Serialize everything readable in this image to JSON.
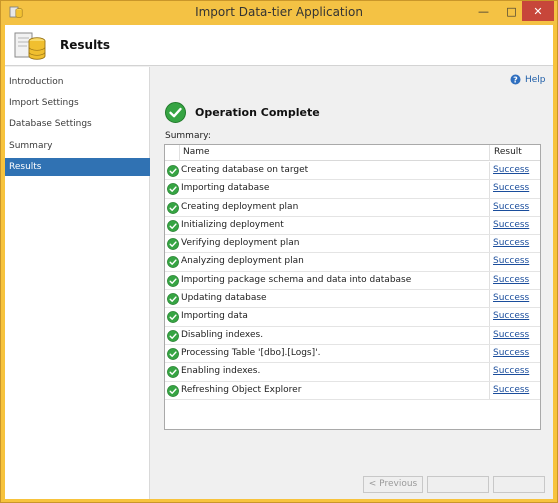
{
  "window": {
    "title": "Import Data-tier Application"
  },
  "titlebar": {
    "minimize": "—",
    "maximize": "□",
    "close": "✕"
  },
  "header": {
    "title": "Results"
  },
  "sidebar": {
    "items": [
      {
        "label": "Introduction",
        "active": false
      },
      {
        "label": "Import Settings",
        "active": false
      },
      {
        "label": "Database Settings",
        "active": false
      },
      {
        "label": "Summary",
        "active": false
      },
      {
        "label": "Results",
        "active": true
      }
    ]
  },
  "main": {
    "help_label": "Help",
    "operation_title": "Operation Complete",
    "summary_label": "Summary:",
    "columns": {
      "name": "Name",
      "result": "Result"
    },
    "rows": [
      {
        "name": "Creating database on target",
        "result": "Success"
      },
      {
        "name": "Importing database",
        "result": "Success"
      },
      {
        "name": "Creating deployment plan",
        "result": "Success"
      },
      {
        "name": "Initializing deployment",
        "result": "Success"
      },
      {
        "name": "Verifying deployment plan",
        "result": "Success"
      },
      {
        "name": "Analyzing deployment plan",
        "result": "Success"
      },
      {
        "name": "Importing package schema and data into database",
        "result": "Success"
      },
      {
        "name": "Updating database",
        "result": "Success"
      },
      {
        "name": "Importing data",
        "result": "Success"
      },
      {
        "name": "Disabling indexes.",
        "result": "Success"
      },
      {
        "name": "Processing Table '[dbo].[Logs]'.",
        "result": "Success"
      },
      {
        "name": "Enabling indexes.",
        "result": "Success"
      },
      {
        "name": "Refreshing Object Explorer",
        "result": "Success"
      }
    ]
  },
  "footer": {
    "previous_label": "< Previous",
    "next_label": "",
    "finish_label": ""
  },
  "colors": {
    "title_bar": "#f4c244",
    "selected_nav": "#3072b3",
    "link": "#1a4d9c",
    "success_green": "#2e9e3a",
    "close_button": "#c7463a"
  },
  "icons": {
    "app": "database-app-icon",
    "header": "database-icon",
    "help": "help-icon",
    "status": "check-circle-icon"
  }
}
